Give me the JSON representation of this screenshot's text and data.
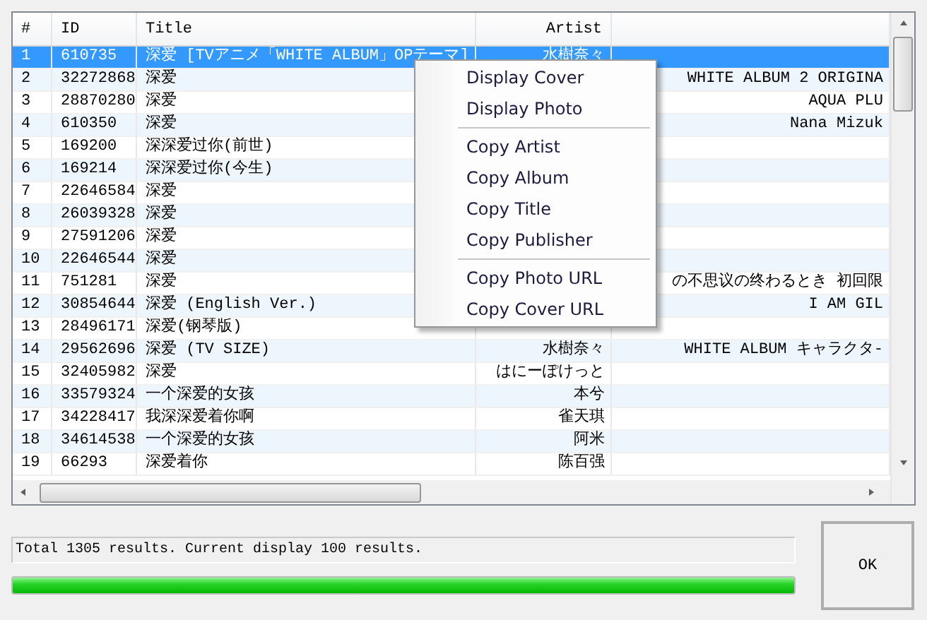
{
  "table": {
    "columns": [
      "#",
      "ID",
      "Title",
      "Artist"
    ],
    "rows": [
      {
        "cells": [
          "1",
          "610735",
          "深爱 [TVアニメ「WHITE ALBUM」OPテーマ]",
          "水樹奈々",
          ""
        ],
        "selected": true
      },
      {
        "cells": [
          "2",
          "32272868",
          "深爱",
          "",
          "WHITE ALBUM 2 ORIGINA"
        ],
        "selected": false
      },
      {
        "cells": [
          "3",
          "28870280",
          "深爱",
          "",
          "AQUA PLU"
        ],
        "selected": false
      },
      {
        "cells": [
          "4",
          "610350",
          "深爱",
          "",
          "Nana Mizuk"
        ],
        "selected": false
      },
      {
        "cells": [
          "5",
          "169200",
          "深深爱过你(前世)",
          "",
          ""
        ],
        "selected": false
      },
      {
        "cells": [
          "6",
          "169214",
          "深深爱过你(今生)",
          "",
          ""
        ],
        "selected": false
      },
      {
        "cells": [
          "7",
          "22646584",
          "深爱",
          "",
          ""
        ],
        "selected": false
      },
      {
        "cells": [
          "8",
          "26039328",
          "深爱",
          "",
          ""
        ],
        "selected": false
      },
      {
        "cells": [
          "9",
          "27591206",
          "深爱",
          "",
          ""
        ],
        "selected": false
      },
      {
        "cells": [
          "10",
          "22646544",
          "深爱",
          "",
          ""
        ],
        "selected": false
      },
      {
        "cells": [
          "11",
          "751281",
          "深爱",
          "",
          "の不思议の终わるとき 初回限"
        ],
        "selected": false
      },
      {
        "cells": [
          "12",
          "30854644",
          "深爱 (English Ver.)",
          "",
          "I AM GIL"
        ],
        "selected": false
      },
      {
        "cells": [
          "13",
          "28496171",
          "深爱(钢琴版)",
          "",
          ""
        ],
        "selected": false
      },
      {
        "cells": [
          "14",
          "29562696",
          "深爱 (TV SIZE)",
          "水樹奈々",
          "WHITE ALBUM キャラクタ-"
        ],
        "selected": false
      },
      {
        "cells": [
          "15",
          "32405982",
          "深爱",
          "はにーぽけっと",
          ""
        ],
        "selected": false
      },
      {
        "cells": [
          "16",
          "33579324",
          "一个深爱的女孩",
          "本兮",
          ""
        ],
        "selected": false
      },
      {
        "cells": [
          "17",
          "34228417",
          "我深深爱着你啊",
          "雀天琪",
          ""
        ],
        "selected": false
      },
      {
        "cells": [
          "18",
          "34614538",
          "一个深爱的女孩",
          "阿米",
          ""
        ],
        "selected": false
      },
      {
        "cells": [
          "19",
          "66293",
          "深爱着你",
          "陈百强",
          ""
        ],
        "selected": false
      }
    ]
  },
  "context_menu": [
    {
      "kind": "item",
      "label": "Display Cover"
    },
    {
      "kind": "item",
      "label": "Display Photo"
    },
    {
      "kind": "separator"
    },
    {
      "kind": "item",
      "label": "Copy Artist"
    },
    {
      "kind": "item",
      "label": "Copy Album"
    },
    {
      "kind": "item",
      "label": "Copy Title"
    },
    {
      "kind": "item",
      "label": "Copy Publisher"
    },
    {
      "kind": "separator"
    },
    {
      "kind": "item",
      "label": "Copy Photo URL"
    },
    {
      "kind": "item",
      "label": "Copy Cover URL"
    }
  ],
  "status": {
    "text": "Total 1305 results. Current display 100 results.",
    "level": 1
  },
  "ok_button": "OK"
}
